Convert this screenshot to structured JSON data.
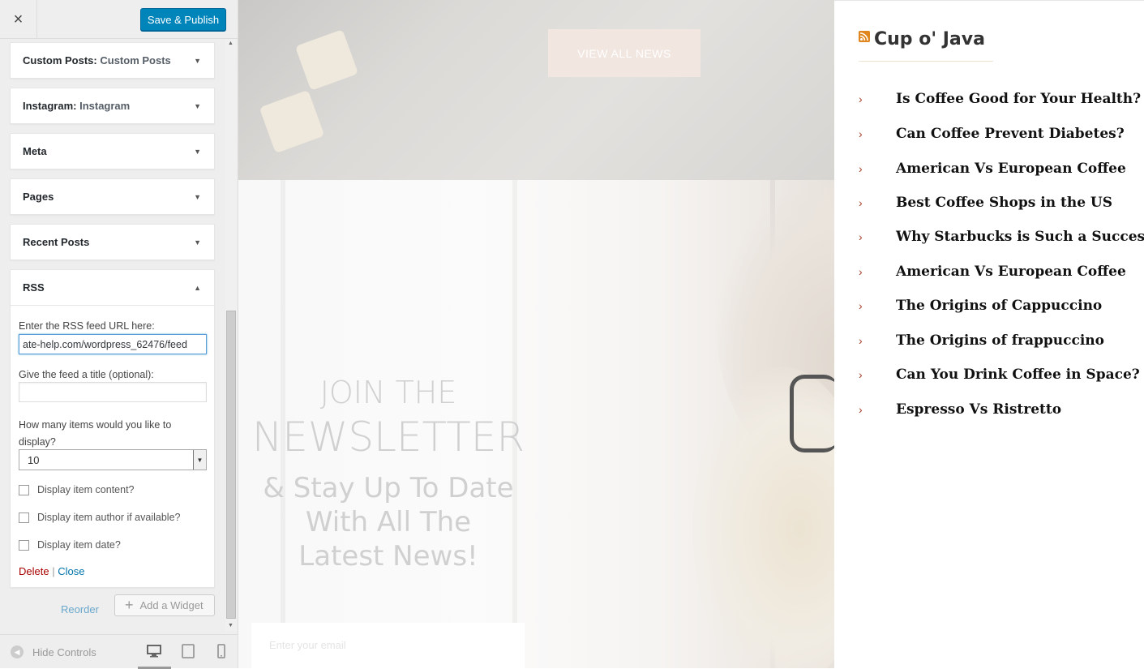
{
  "customizer": {
    "close_label": "×",
    "publish_label": "Save & Publish",
    "widgets": [
      {
        "title": "Custom Posts:",
        "subtitle": "Custom Posts"
      },
      {
        "title": "Instagram:",
        "subtitle": "Instagram"
      },
      {
        "title": "Meta",
        "subtitle": ""
      },
      {
        "title": "Pages",
        "subtitle": ""
      },
      {
        "title": "Recent Posts",
        "subtitle": ""
      }
    ],
    "rss": {
      "title": "RSS",
      "url_label": "Enter the RSS feed URL here:",
      "url_value": "ate-help.com/wordpress_62476/feed",
      "feed_title_label": "Give the feed a title (optional):",
      "feed_title_value": "",
      "items_label": "How many items would you like to display?",
      "items_value": "10",
      "checkbox_content": "Display item content?",
      "checkbox_author": "Display item author if available?",
      "checkbox_date": "Display item date?",
      "delete_label": "Delete",
      "separator": "|",
      "close_label": "Close"
    },
    "reorder_label": "Reorder",
    "add_widget_label": "Add a Widget",
    "hide_controls_label": "Hide Controls"
  },
  "preview": {
    "view_all_label": "VIEW ALL NEWS",
    "newsletter": {
      "line1": "JOIN THE",
      "line2": "NEWSLETTER",
      "line3": "& Stay Up To Date",
      "line4": "With All The",
      "line5": "Latest News!"
    },
    "email_placeholder": "Enter your email"
  },
  "rss_widget": {
    "title": "Cup o' Java",
    "items": [
      "Is Coffee Good for Your Health?",
      "Can Coffee Prevent Diabetes?",
      "American Vs European Coffee",
      "Best Coffee Shops in the US",
      "Why Starbucks is Such a Success?",
      "American Vs European Coffee",
      "The Origins of Cappuccino",
      "The Origins of frappuccino",
      "Can You Drink Coffee in Space?",
      "Espresso Vs Ristretto"
    ]
  },
  "colors": {
    "publish_bg": "#0085ba",
    "rss_orange": "#e0861f",
    "chevron": "#a5412a",
    "delete": "#aa0000",
    "link": "#0073aa"
  }
}
